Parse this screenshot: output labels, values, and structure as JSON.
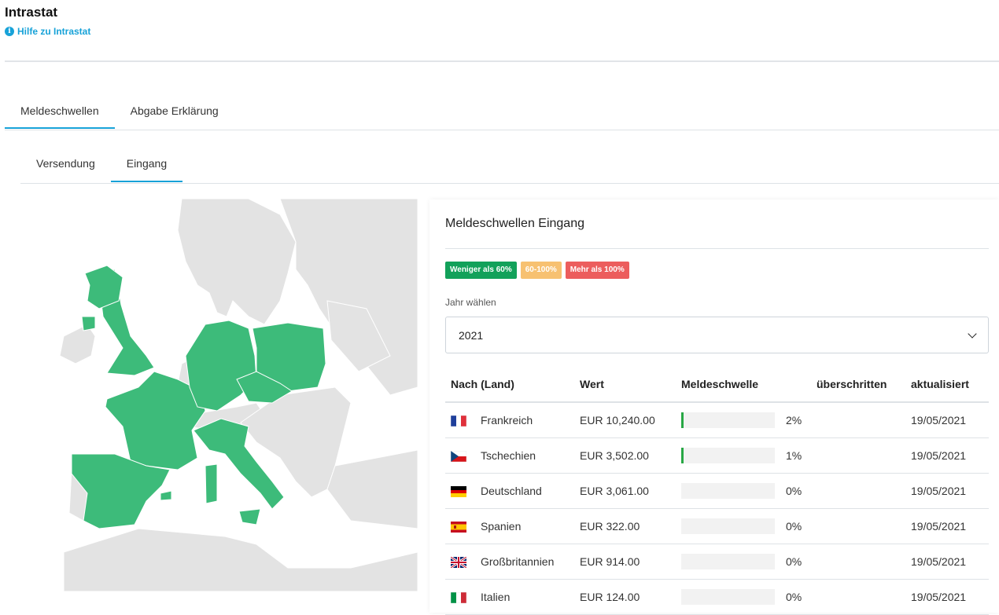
{
  "header": {
    "title": "Intrastat",
    "help_icon": "info-icon",
    "help_label": "Hilfe zu Intrastat"
  },
  "tabs": [
    {
      "label": "Meldeschwellen",
      "active": true
    },
    {
      "label": "Abgabe Erklärung",
      "active": false
    }
  ],
  "subtabs": [
    {
      "label": "Versendung",
      "active": false
    },
    {
      "label": "Eingang",
      "active": true
    }
  ],
  "map": {
    "highlight_color": "#3dbb7a",
    "base_color": "#e3e3e3",
    "highlighted_countries": [
      "Frankreich",
      "Tschechien",
      "Deutschland",
      "Spanien",
      "Großbritannien",
      "Italien",
      "Polen"
    ]
  },
  "panel": {
    "title": "Meldeschwellen Eingang",
    "legend": [
      {
        "label": "Weniger als 60%",
        "color": "#12a15a"
      },
      {
        "label": "60-100%",
        "color": "#f7c171"
      },
      {
        "label": "Mehr als 100%",
        "color": "#ec5d5d"
      }
    ],
    "year_label": "Jahr wählen",
    "year_value": "2021",
    "columns": [
      "Nach (Land)",
      "Wert",
      "Meldeschwelle",
      "überschritten",
      "aktualisiert"
    ],
    "rows": [
      {
        "flag": "flag-fr-icon",
        "country": "Frankreich",
        "value": "EUR 10,240.00",
        "percent_label": "2%",
        "percent": 2,
        "exceeded": "",
        "updated": "19/05/2021"
      },
      {
        "flag": "flag-cz-icon",
        "country": "Tschechien",
        "value": "EUR 3,502.00",
        "percent_label": "1%",
        "percent": 1,
        "exceeded": "",
        "updated": "19/05/2021"
      },
      {
        "flag": "flag-de-icon",
        "country": "Deutschland",
        "value": "EUR 3,061.00",
        "percent_label": "0%",
        "percent": 0,
        "exceeded": "",
        "updated": "19/05/2021"
      },
      {
        "flag": "flag-es-icon",
        "country": "Spanien",
        "value": "EUR 322.00",
        "percent_label": "0%",
        "percent": 0,
        "exceeded": "",
        "updated": "19/05/2021"
      },
      {
        "flag": "flag-gb-icon",
        "country": "Großbritannien",
        "value": "EUR 914.00",
        "percent_label": "0%",
        "percent": 0,
        "exceeded": "",
        "updated": "19/05/2021"
      },
      {
        "flag": "flag-it-icon",
        "country": "Italien",
        "value": "EUR 124.00",
        "percent_label": "0%",
        "percent": 0,
        "exceeded": "",
        "updated": "19/05/2021"
      }
    ]
  }
}
